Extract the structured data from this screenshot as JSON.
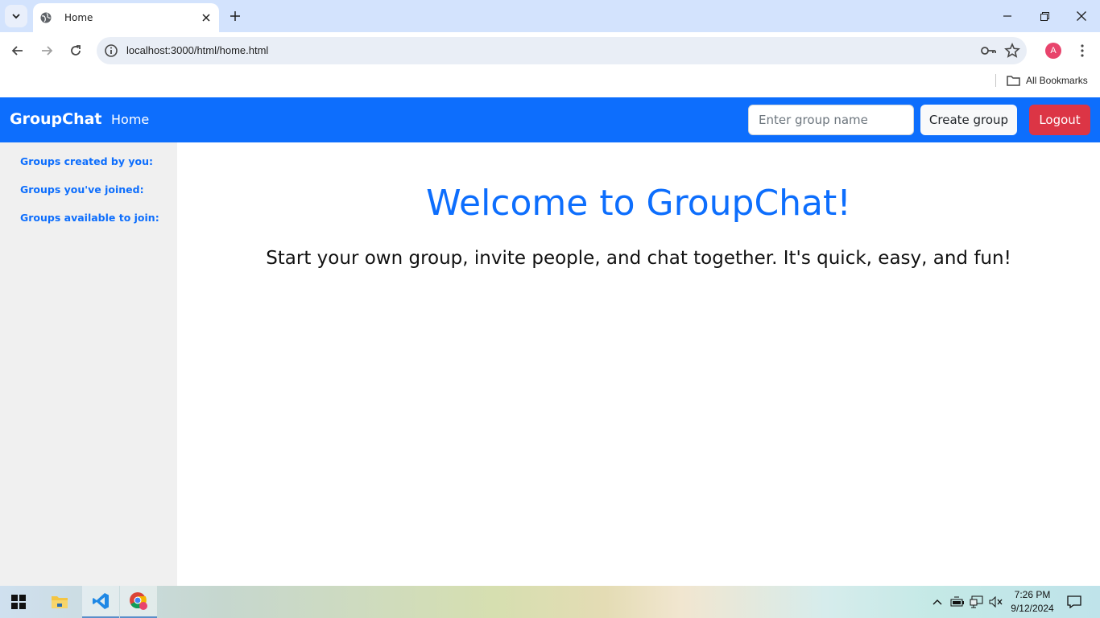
{
  "browser": {
    "tab_title": "Home",
    "url": "localhost:3000/html/home.html",
    "bookmarks_label": "All Bookmarks",
    "profile_initial": "A"
  },
  "navbar": {
    "brand": "GroupChat",
    "home_link": "Home",
    "group_input_placeholder": "Enter group name",
    "create_button": "Create group",
    "logout_button": "Logout"
  },
  "sidebar": {
    "items": [
      {
        "label": "Groups created by you:"
      },
      {
        "label": "Groups you've joined:"
      },
      {
        "label": "Groups available to join:"
      }
    ]
  },
  "main": {
    "title": "Welcome to GroupChat!",
    "tagline": "Start your own group, invite people, and chat together. It's quick, easy, and fun!"
  },
  "taskbar": {
    "time": "7:26 PM",
    "date": "9/12/2024"
  },
  "colors": {
    "primary": "#0d6efd",
    "danger": "#dc3545",
    "sidebar_bg": "#f0f0f0"
  }
}
